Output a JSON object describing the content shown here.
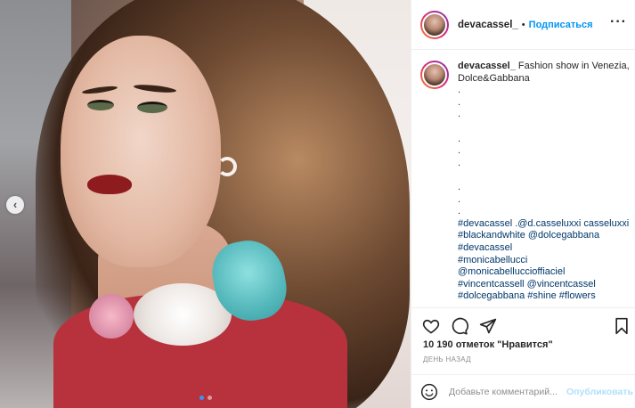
{
  "post": {
    "username": "devacassel_",
    "separator": "•",
    "follow_label": "Подписаться",
    "more_label": "···",
    "caption": {
      "username": "devacassel_",
      "text_line1": "Fashion show in Venezia,",
      "text_line2": "Dolce&Gabbana",
      "dots": [
        ".",
        ".",
        ".",
        ".",
        ".",
        ".",
        ".",
        ".",
        "."
      ],
      "hashtags": [
        "#devacassel .@d.casseluxxi casseluxxi",
        "#blackandwhite @dolcegabbana",
        "#devacassel",
        "#monicabellucci",
        "@monicabelluccioffiaciel",
        "#vincentcassell @vincentcassel",
        "#dolcegabbana #shine #flowers"
      ]
    },
    "likes": "10 190 отметок \"Нравится\"",
    "time": "ДЕНЬ НАЗАД",
    "comment_placeholder": "Добавьте комментарий...",
    "publish_label": "Опубликовать",
    "nav_prev": "‹",
    "carousel": {
      "total": 2,
      "active": 1
    },
    "icons": [
      "heart-icon",
      "comment-icon",
      "share-icon",
      "bookmark-icon",
      "emoji-icon",
      "chevron-left-icon"
    ],
    "colors": {
      "accent": "#0095f6",
      "publish_disabled": "#b2dffc",
      "hashtag": "#00376b",
      "muted": "#8e8e8e"
    }
  }
}
